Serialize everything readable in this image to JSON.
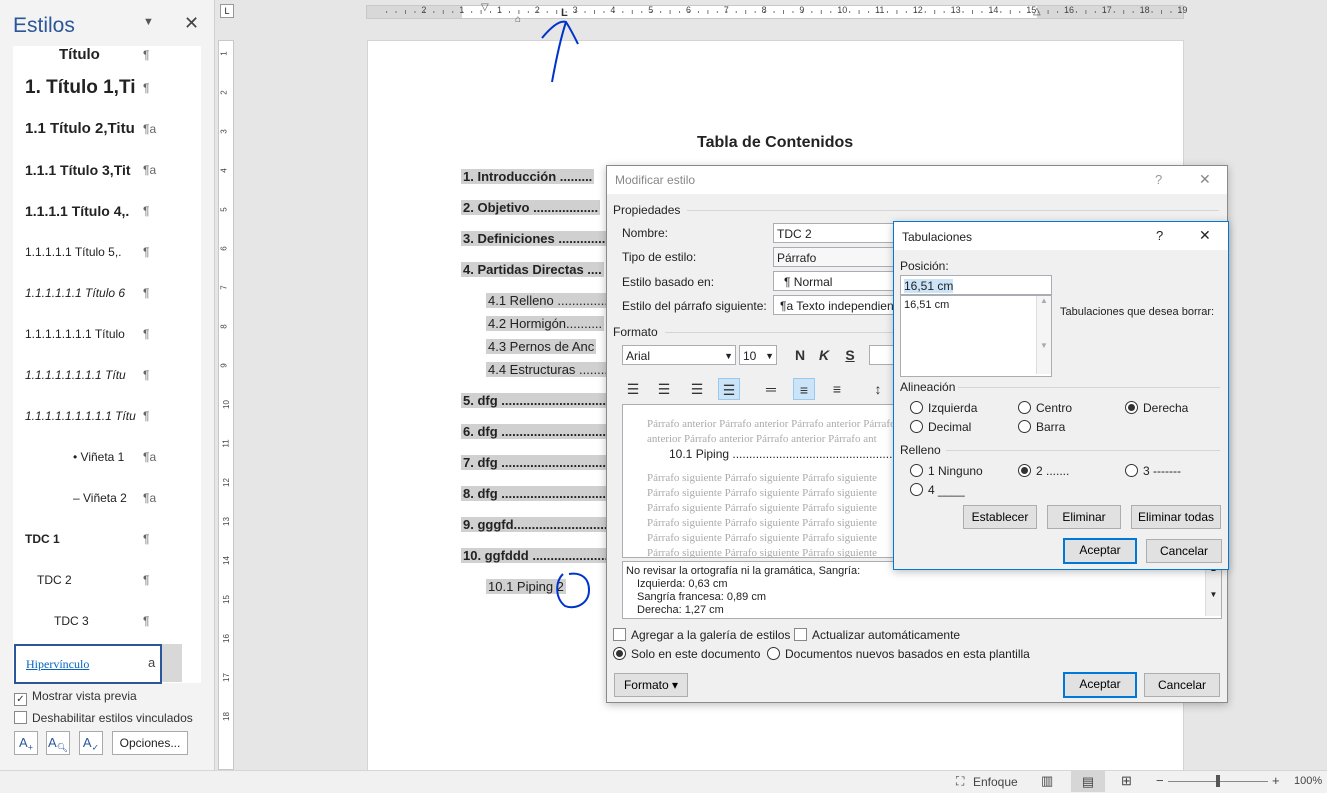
{
  "styles_pane": {
    "title": "Estilos",
    "items": [
      {
        "label": "Título",
        "mark": "¶"
      },
      {
        "label": "1.  Título 1,Ti",
        "mark": "¶"
      },
      {
        "label": "1.1  Título 2,Titu",
        "mark": "¶a"
      },
      {
        "label": "1.1.1  Título 3,Tit",
        "mark": "¶a"
      },
      {
        "label": "1.1.1.1  Título 4,.",
        "mark": "¶"
      },
      {
        "label": "1.1.1.1.1  Título 5,.",
        "mark": "¶"
      },
      {
        "label": "1.1.1.1.1.1  Título 6",
        "mark": "¶"
      },
      {
        "label": "1.1.1.1.1.1.1  Título",
        "mark": "¶"
      },
      {
        "label": "1.1.1.1.1.1.1.1  Títu",
        "mark": "¶"
      },
      {
        "label": "1.1.1.1.1.1.1.1.1  Títu",
        "mark": "¶"
      },
      {
        "label": "•  Viñeta 1",
        "mark": "¶a"
      },
      {
        "label": "–    Viñeta 2",
        "mark": "¶a"
      },
      {
        "label": "TDC 1",
        "mark": "¶"
      },
      {
        "label": "TDC 2",
        "mark": "¶"
      },
      {
        "label": "TDC 3",
        "mark": "¶"
      }
    ],
    "selected": {
      "label": "Hipervínculo",
      "mark": "a"
    },
    "show_preview": "Mostrar vista previa",
    "disable_linked": "Deshabilitar estilos vinculados",
    "options_button": "Opciones..."
  },
  "ruler": {
    "h_labels": [
      "2",
      "1",
      "1",
      "2",
      "3",
      "4",
      "5",
      "6",
      "7",
      "8",
      "9",
      "10",
      "11",
      "12",
      "13",
      "14",
      "15",
      "16",
      "17",
      "18",
      "19"
    ],
    "v_labels": [
      "1",
      "2",
      "3",
      "4",
      "5",
      "6",
      "7",
      "8",
      "9",
      "10",
      "11",
      "12",
      "13",
      "14",
      "15",
      "16",
      "17",
      "18"
    ]
  },
  "document": {
    "toc_title": "Tabla de Contenidos",
    "entries": [
      {
        "text": "1.   Introducción .........",
        "level": 1
      },
      {
        "text": "2.   Objetivo ..................",
        "level": 1
      },
      {
        "text": "3.   Definiciones ..............",
        "level": 1
      },
      {
        "text": "4.   Partidas Directas ....",
        "level": 1
      },
      {
        "text": "4.1    Relleno ..............",
        "level": 2
      },
      {
        "text": "4.2    Hormigón..........",
        "level": 2
      },
      {
        "text": "4.3    Pernos de Anc",
        "level": 2
      },
      {
        "text": "4.4    Estructuras ........",
        "level": 2
      },
      {
        "text": "5.   dfg ................................",
        "level": 1
      },
      {
        "text": "6.   dfg ................................",
        "level": 1
      },
      {
        "text": "7.   dfg ................................",
        "level": 1
      },
      {
        "text": "8.   dfg ................................",
        "level": 1
      },
      {
        "text": "9.   gggfd..............................",
        "level": 1
      },
      {
        "text": "10.  ggfddd ..........................",
        "level": 1
      },
      {
        "text": "10.1  Piping  2",
        "level": 2
      }
    ]
  },
  "modify_style_dialog": {
    "title": "Modificar estilo",
    "help": "?",
    "close": "✕",
    "properties_header": "Propiedades",
    "name_label": "Nombre:",
    "name_value": "TDC 2",
    "type_label": "Tipo de estilo:",
    "type_value": "Párrafo",
    "based_label": "Estilo basado en:",
    "based_value": "¶  Normal",
    "next_label": "Estilo del párrafo siguiente:",
    "next_value": "¶a  Texto independien",
    "format_header": "Formato",
    "font_value": "Arial",
    "size_value": "10",
    "bold": "N",
    "italic": "K",
    "underline": "S",
    "preview_prev": "Párrafo anterior Párrafo anterior Párrafo anterior Párrafo anterior Párrafo anterior Párrafo anterior Párrafo ant",
    "preview_current": "10.1  Piping .......................................................................",
    "preview_next": "Párrafo siguiente Párrafo siguiente Párrafo siguiente",
    "description": [
      "No revisar la ortografía ni la gramática, Sangría:",
      "Izquierda:  0,63 cm",
      "Sangría francesa:  0,89 cm",
      "Derecha:  1,27 cm"
    ],
    "add_gallery": "Agregar a la galería de estilos",
    "auto_update": "Actualizar automáticamente",
    "only_doc": "Solo en este documento",
    "new_docs": "Documentos nuevos basados en esta plantilla",
    "format_button": "Formato ▾",
    "ok": "Aceptar",
    "cancel": "Cancelar"
  },
  "tabs_dialog": {
    "title": "Tabulaciones",
    "help": "?",
    "close": "✕",
    "position_label": "Posición:",
    "position_value": "16,51 cm",
    "list_items": [
      "16,51 cm"
    ],
    "clear_label": "Tabulaciones que desea borrar:",
    "alignment_header": "Alineación",
    "align_left": "Izquierda",
    "align_center": "Centro",
    "align_right": "Derecha",
    "align_decimal": "Decimal",
    "align_bar": "Barra",
    "leader_header": "Relleno",
    "leader_1": "1 Ninguno",
    "leader_2": "2 .......",
    "leader_3": "3 -------",
    "leader_4": "4 ____",
    "set": "Establecer",
    "clear": "Eliminar",
    "clear_all": "Eliminar todas",
    "ok": "Aceptar",
    "cancel": "Cancelar"
  },
  "status_bar": {
    "focus": "Enfoque",
    "zoom": "100%",
    "minus": "−",
    "plus": "+"
  },
  "colors": {
    "accent": "#2b579a",
    "annotation": "#0033cc",
    "toc_highlight": "#d0d0d0"
  }
}
